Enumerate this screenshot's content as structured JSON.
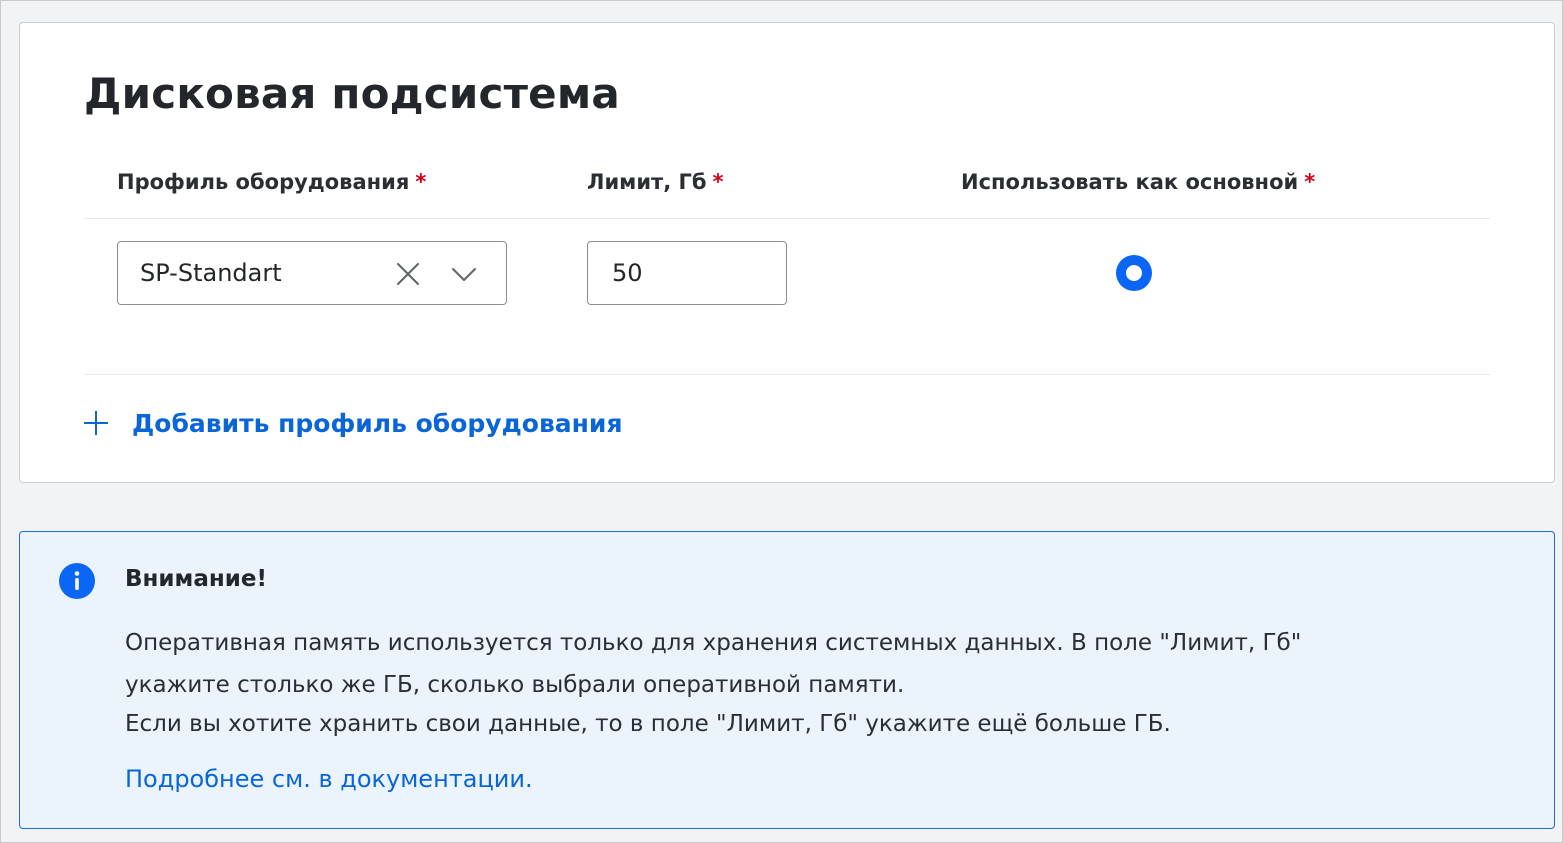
{
  "disk_section": {
    "title": "Дисковая подсистема",
    "columns": {
      "profile": "Профиль оборудования",
      "limit": "Лимит, Гб",
      "primary": "Использовать как основной",
      "required_mark": "*"
    },
    "row": {
      "profile_value": "SP-Standart",
      "limit_value": "50",
      "primary_selected": true
    },
    "add_profile_label": "Добавить профиль оборудования"
  },
  "alert": {
    "title": "Внимание!",
    "lines": [
      "Оперативная память используется только для хранения системных данных. В поле \"Лимит, Гб\"",
      "укажите столько же ГБ, сколько выбрали оперативной памяти.",
      "Если вы хотите хранить свои данные, то в поле \"Лимит, Гб\" укажите ещё больше ГБ."
    ],
    "link_text": "Подробнее см. в документации."
  },
  "colors": {
    "accent": "#0a66f5",
    "link": "#0a66d8",
    "required": "#d0021b",
    "alert_bg": "#ebf3fd",
    "alert_border": "#1f6fd6"
  },
  "icons": {
    "clear": "close-icon",
    "dropdown": "chevron-down-icon",
    "add": "plus-icon",
    "info": "info-icon"
  }
}
